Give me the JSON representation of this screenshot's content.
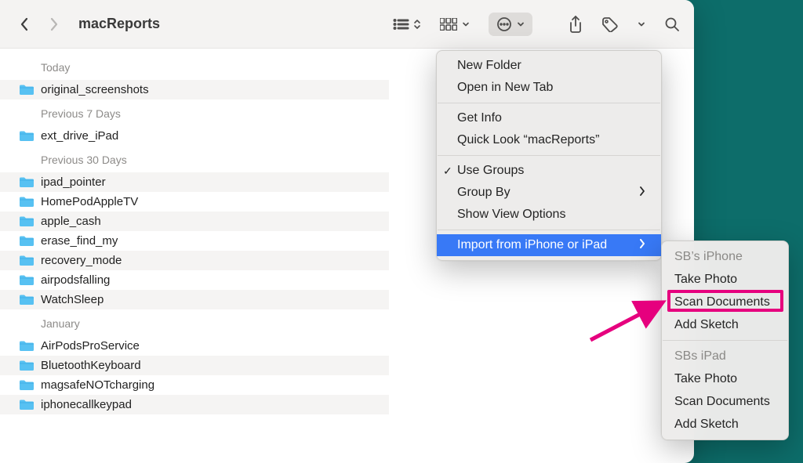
{
  "window": {
    "title": "macReports"
  },
  "sections": [
    {
      "label": "Today",
      "items": [
        "original_screenshots"
      ]
    },
    {
      "label": "Previous 7 Days",
      "items": [
        "ext_drive_iPad"
      ]
    },
    {
      "label": "Previous 30 Days",
      "items": [
        "ipad_pointer",
        "HomePodAppleTV",
        "apple_cash",
        "erase_find_my",
        "recovery_mode",
        "airpodsfalling",
        "WatchSleep"
      ]
    },
    {
      "label": "January",
      "items": [
        "AirPodsProService",
        "BluetoothKeyboard",
        "magsafeNOTcharging",
        "iphonecallkeypad"
      ]
    }
  ],
  "menu": {
    "new_folder": "New Folder",
    "open_tab": "Open in New Tab",
    "get_info": "Get Info",
    "quick_look": "Quick Look “macReports”",
    "use_groups": "Use Groups",
    "group_by": "Group By",
    "show_view": "Show View Options",
    "import": "Import from iPhone or iPad"
  },
  "submenu": {
    "dev1_header": "SB’s iPhone",
    "dev1_photo": "Take Photo",
    "dev1_scan": "Scan Documents",
    "dev1_sketch": "Add Sketch",
    "dev2_header": "SBs iPad",
    "dev2_photo": "Take Photo",
    "dev2_scan": "Scan Documents",
    "dev2_sketch": "Add Sketch"
  }
}
